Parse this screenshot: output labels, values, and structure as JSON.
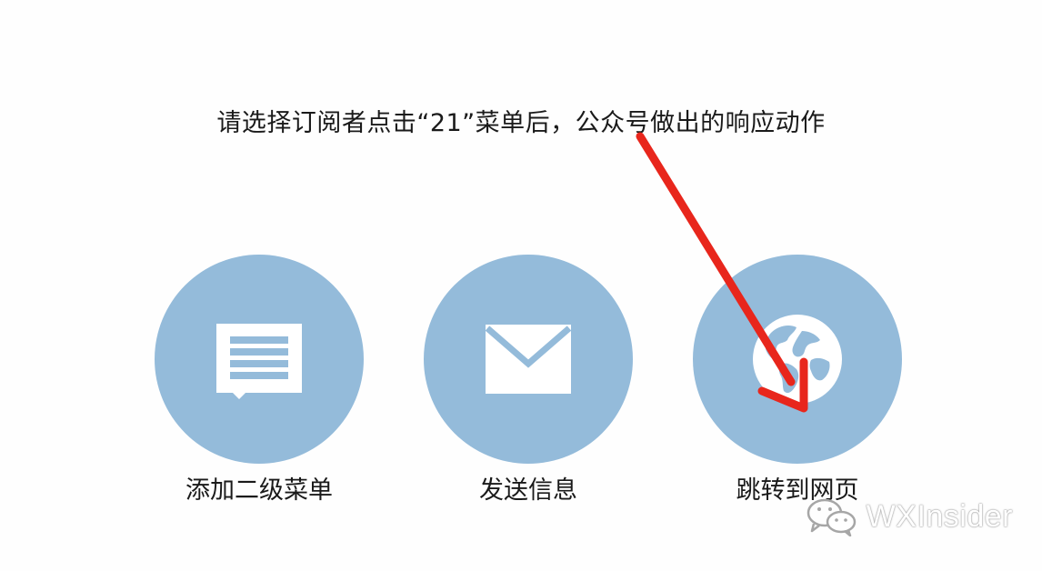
{
  "prompt": {
    "text": "请选择订阅者点击“21”菜单后，公众号做出的响应动作"
  },
  "options": [
    {
      "label": "添加二级菜单",
      "icon": "chat-bubble-icon"
    },
    {
      "label": "发送信息",
      "icon": "envelope-icon"
    },
    {
      "label": "跳转到网页",
      "icon": "globe-icon"
    }
  ],
  "annotation": {
    "arrow_color": "#e8261c",
    "points_to": "跳转到网页"
  },
  "watermark": {
    "text": "WXInsider",
    "icon": "wechat-logo-icon"
  },
  "colors": {
    "circle": "#94bbda",
    "icon": "#ffffff",
    "text": "#1a1a1a",
    "background": "#fefefe"
  }
}
